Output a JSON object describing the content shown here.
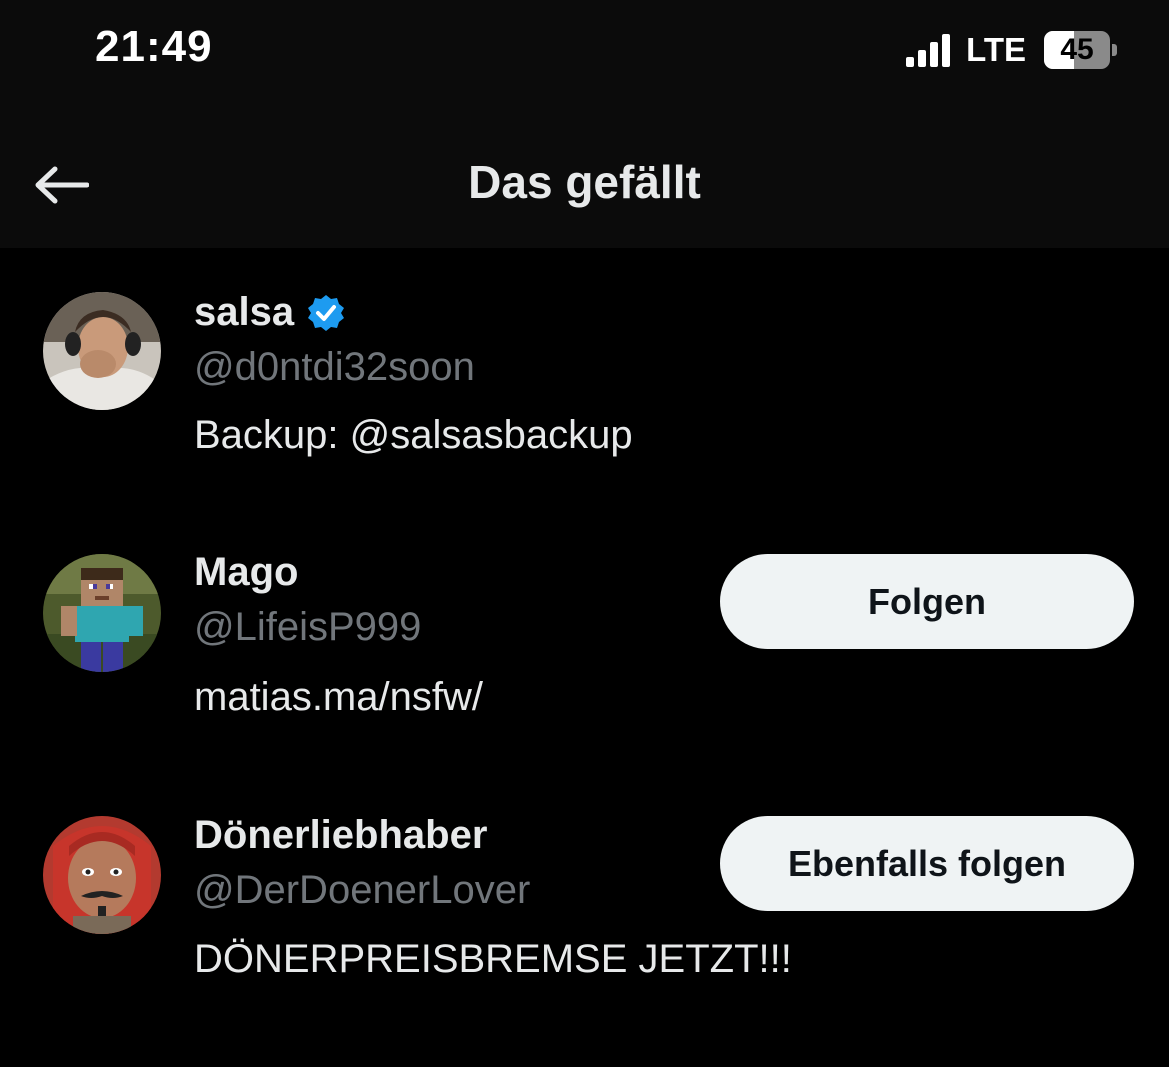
{
  "status_bar": {
    "time": "21:49",
    "network": "LTE",
    "battery": "45",
    "battery_level": 0.45,
    "signal_icon": "cellular-signal-icon"
  },
  "header": {
    "title": "Das gefällt",
    "back_icon": "back-arrow-icon"
  },
  "users": [
    {
      "name": "salsa",
      "verified": true,
      "verified_color": "#1d9bf0",
      "handle": "@d0ntdi32soon",
      "bio": "Backup: @salsasbackup",
      "button_label": ""
    },
    {
      "name": "Mago",
      "verified": false,
      "handle": "@LifeisP999",
      "bio": "matias.ma/nsfw/",
      "button_label": "Folgen"
    },
    {
      "name": "Dönerliebhaber",
      "verified": false,
      "handle": "@DerDoenerLover",
      "bio": "DÖNERPREISBREMSE JETZT!!!",
      "button_label": "Ebenfalls folgen"
    }
  ],
  "colors": {
    "background": "#000000",
    "header_background": "#0b0b0b",
    "secondary_text": "#71767b",
    "button_background": "#eff3f4",
    "verified_blue": "#1d9bf0"
  }
}
